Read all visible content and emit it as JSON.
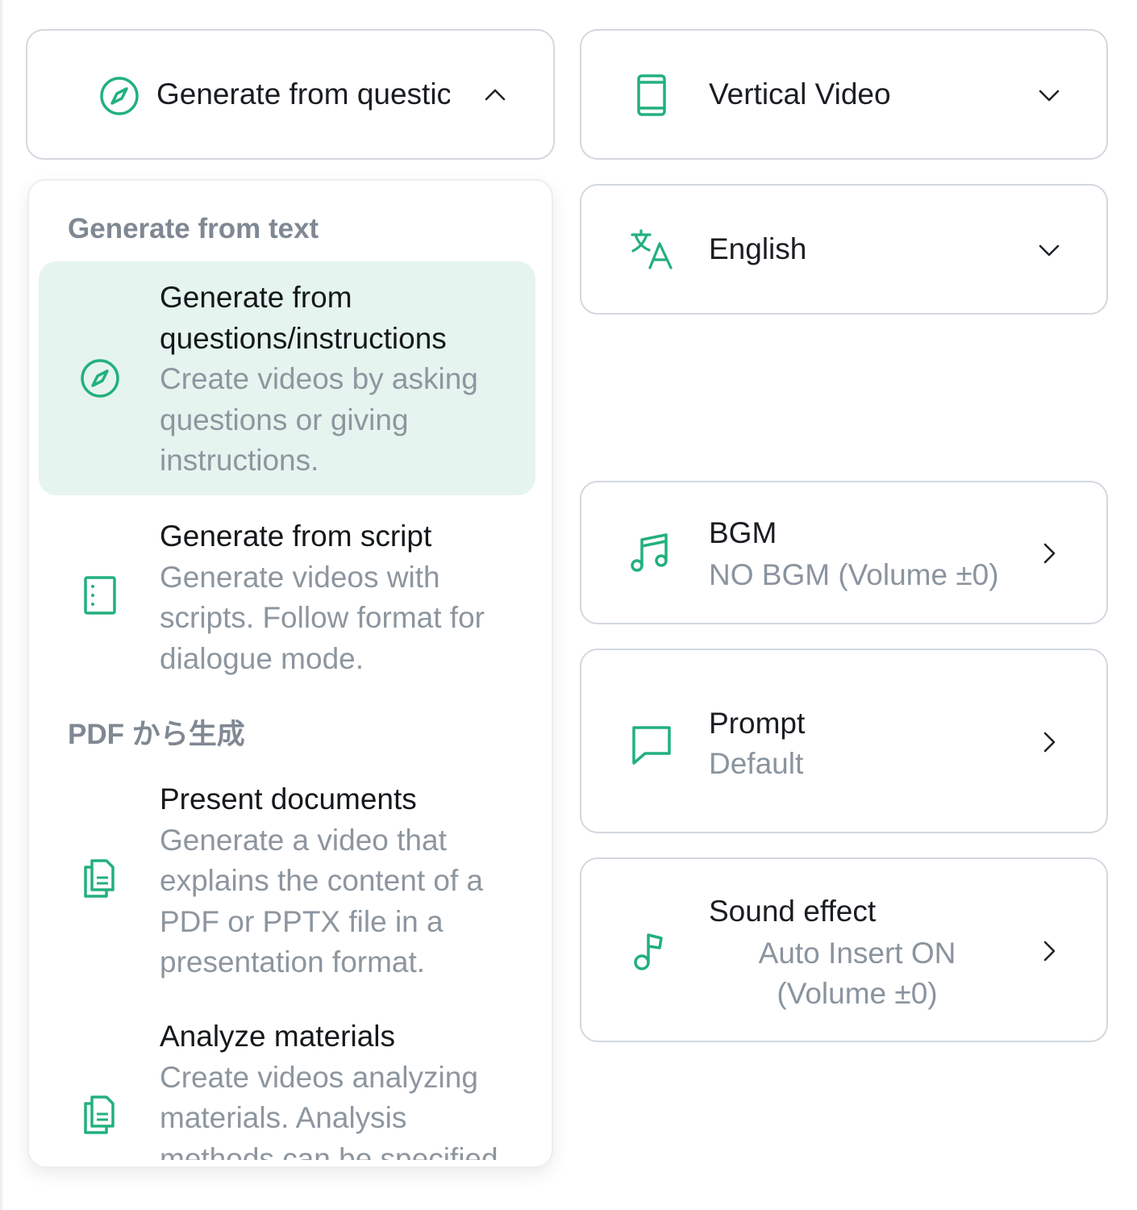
{
  "mode_select": {
    "value": "Generate from questic",
    "icon": "compass-icon",
    "expanded": true
  },
  "format_select": {
    "value": "Vertical Video",
    "icon": "phone-icon"
  },
  "language_select": {
    "value": "English",
    "icon": "translate-icon"
  },
  "bgm": {
    "title": "BGM",
    "value": "NO BGM (Volume ±0)",
    "icon": "music-notes-icon"
  },
  "prompt": {
    "title": "Prompt",
    "value": "Default",
    "icon": "speech-bubble-icon"
  },
  "sound_effect": {
    "title": "Sound effect",
    "value_line1": "Auto Insert ON",
    "value_line2": "(Volume ±0)",
    "icon": "music-note-icon"
  },
  "dropdown": {
    "groups": [
      {
        "label": "Generate from text",
        "options": [
          {
            "title_line1": "Generate from",
            "title_line2": "questions/instructions",
            "desc_line1": "Create videos by asking",
            "desc_line2": "questions or giving",
            "desc_line3": "instructions.",
            "icon": "compass-icon",
            "selected": true
          },
          {
            "title_line1": "Generate from script",
            "desc_line1": "Generate videos with",
            "desc_line2": "scripts. Follow format for",
            "desc_line3": "dialogue mode.",
            "icon": "script-icon",
            "selected": false
          }
        ]
      },
      {
        "label": "PDF から生成",
        "options": [
          {
            "title_line1": "Present documents",
            "desc_line1": "Generate a video that",
            "desc_line2": "explains the content of a",
            "desc_line3": "PDF or PPTX file in a",
            "desc_line4": "presentation format.",
            "icon": "documents-icon",
            "selected": false
          },
          {
            "title_line1": "Analyze materials",
            "desc_line1": "Create videos analyzing",
            "desc_line2": "materials. Analysis",
            "desc_line3": "methods can be specified",
            "icon": "documents-icon",
            "selected": false
          }
        ]
      }
    ]
  },
  "colors": {
    "accent": "#22b07d",
    "border": "#d3d8de",
    "selected_bg": "#e5f4ee",
    "muted_text": "#8a949f"
  }
}
